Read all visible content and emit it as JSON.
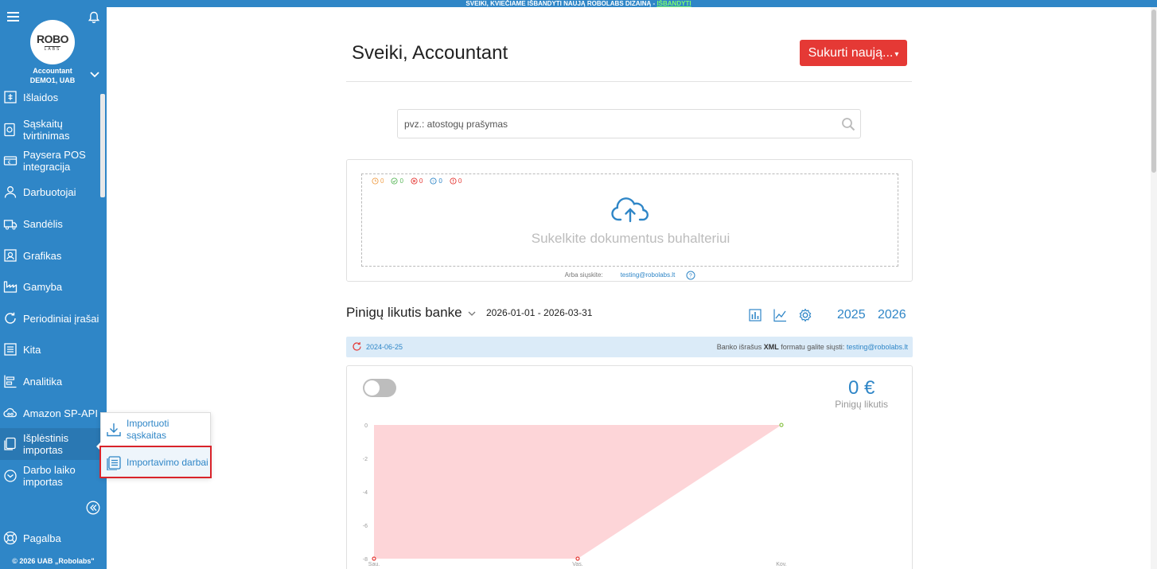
{
  "banner": {
    "text": "SVEIKI, KVIEČIAME IŠBANDYTI NAUJĄ ROBOLABS DIZAINĄ - ",
    "link": "IŠBANDYTI"
  },
  "sidebar": {
    "logo_top": "ROBO",
    "logo_bottom": "LABS",
    "user_name": "Accountant",
    "company": "DEMO1, UAB",
    "items": [
      {
        "label": "Išlaidos",
        "icon": "expense-icon"
      },
      {
        "label": "Sąskaitų tvirtinimas",
        "icon": "approval-icon"
      },
      {
        "label": "Paysera POS integracija",
        "icon": "pos-icon"
      },
      {
        "label": "Darbuotojai",
        "icon": "employees-icon"
      },
      {
        "label": "Sandėlis",
        "icon": "warehouse-icon"
      },
      {
        "label": "Grafikas",
        "icon": "schedule-icon"
      },
      {
        "label": "Gamyba",
        "icon": "factory-icon"
      },
      {
        "label": "Periodiniai įrašai",
        "icon": "recurring-icon"
      },
      {
        "label": "Kita",
        "icon": "other-icon"
      },
      {
        "label": "Analitika",
        "icon": "analytics-icon"
      },
      {
        "label": "Amazon SP-API",
        "icon": "amazon-icon"
      },
      {
        "label": "Išplėstinis importas",
        "icon": "import-icon"
      },
      {
        "label": "Darbo laiko importas",
        "icon": "clock-icon"
      }
    ],
    "help": "Pagalba",
    "footer": "© 2026 UAB „Robolabs\""
  },
  "flyout": {
    "items": [
      {
        "label": "Importuoti sąskaitas",
        "icon": "download-icon"
      },
      {
        "label": "Importavimo darbai",
        "icon": "jobs-icon"
      }
    ]
  },
  "header": {
    "greeting": "Sveiki, Accountant",
    "create_button": "Sukurti naują..."
  },
  "search": {
    "placeholder": "pvz.: atostogų prašymas"
  },
  "upload": {
    "counters": [
      {
        "icon": "pending-icon",
        "value": "0",
        "color": "#f0a04b"
      },
      {
        "icon": "done-icon",
        "value": "0",
        "color": "#5cb85c"
      },
      {
        "icon": "failed-icon",
        "value": "0",
        "color": "#e53935"
      },
      {
        "icon": "question-icon",
        "value": "0",
        "color": "#2f86c7"
      },
      {
        "icon": "warning-icon",
        "value": "0",
        "color": "#e53935"
      }
    ],
    "text": "Sukelkite dokumentus buhalteriui",
    "alt_label": "Arba siųskite:",
    "alt_email": "testing@robolabs.lt"
  },
  "bank": {
    "title": "Pinigų likutis banke",
    "range": "2026-01-01 - 2026-03-31",
    "years": [
      "2025",
      "2026"
    ],
    "info_date": "2024-06-25",
    "info_text_before": "Banko išrašus ",
    "info_bold": "XML",
    "info_text_after": " formatu galite siųsti: ",
    "info_email": "testing@robolabs.lt",
    "balance_value": "0 €",
    "balance_label": "Pinigų likutis"
  },
  "chart_data": {
    "type": "area",
    "categories": [
      "Sau.",
      "Vas.",
      "Kov."
    ],
    "values": [
      -8,
      -8,
      0
    ],
    "ylim": [
      -8,
      0
    ],
    "yticks": [
      "0",
      "-2",
      "-4",
      "-6",
      "-8"
    ],
    "fill_color": "#fdd5d8",
    "point_colors": [
      "#e53935",
      "#e53935",
      "#8bc34a"
    ]
  },
  "colors": {
    "brand": "#2f86c7",
    "accent": "#e53935",
    "highlight": "#d9232a"
  }
}
